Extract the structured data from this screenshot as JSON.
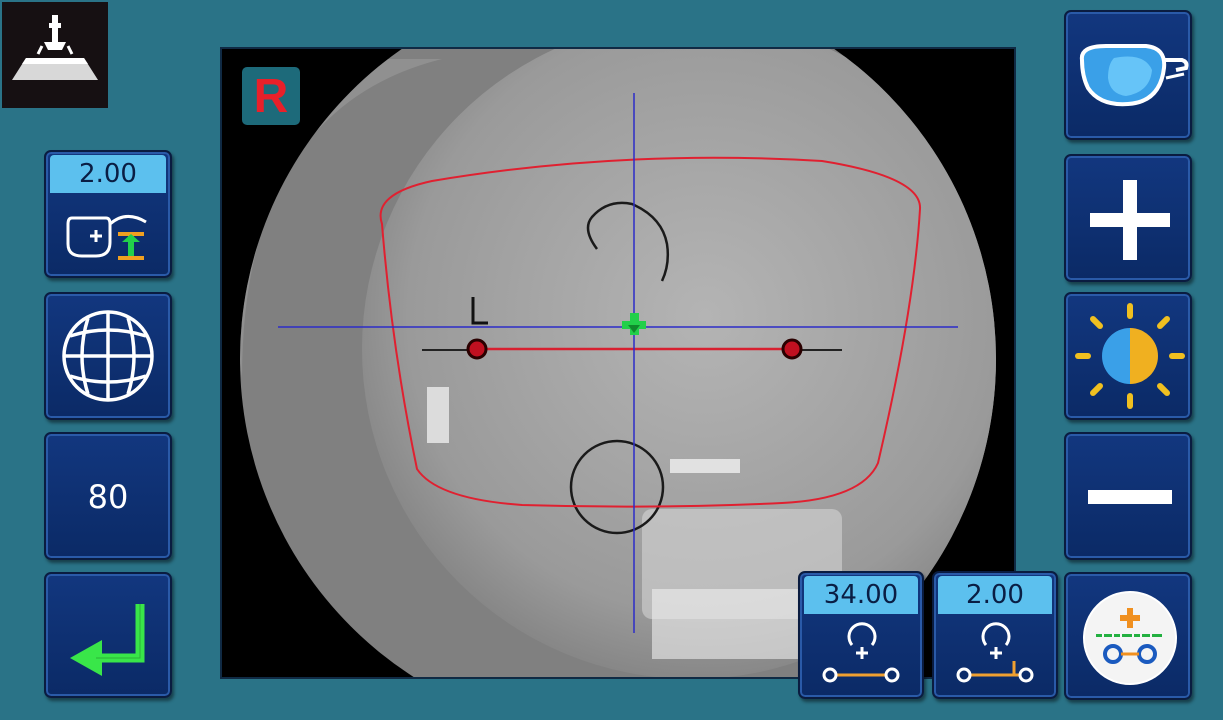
{
  "viewer": {
    "lens_side": "R",
    "mark_label": "L"
  },
  "left_panel": {
    "add_value": "2.00",
    "numeric_value": "80"
  },
  "bottom_panel": {
    "distance_value": "34.00",
    "height_value": "2.00"
  },
  "colors": {
    "background": "#2a7387",
    "button": "#0f3276",
    "value_header": "#5cc0ee",
    "frame_outline": "#e02030",
    "crosshair": "#2c2cc8",
    "center_marker": "#22d04a",
    "enter_arrow": "#39e649"
  },
  "icons": {
    "corner": "lensmeter-support-icon",
    "add_button": "progressive-add-icon",
    "grid_button": "globe-grid-icon",
    "enter_button": "enter-return-icon",
    "glasses_button": "glasses-lens-icon",
    "plus_button": "plus-icon",
    "brightness_button": "brightness-icon",
    "minus_button": "minus-icon",
    "centering_button": "centering-target-icon"
  }
}
